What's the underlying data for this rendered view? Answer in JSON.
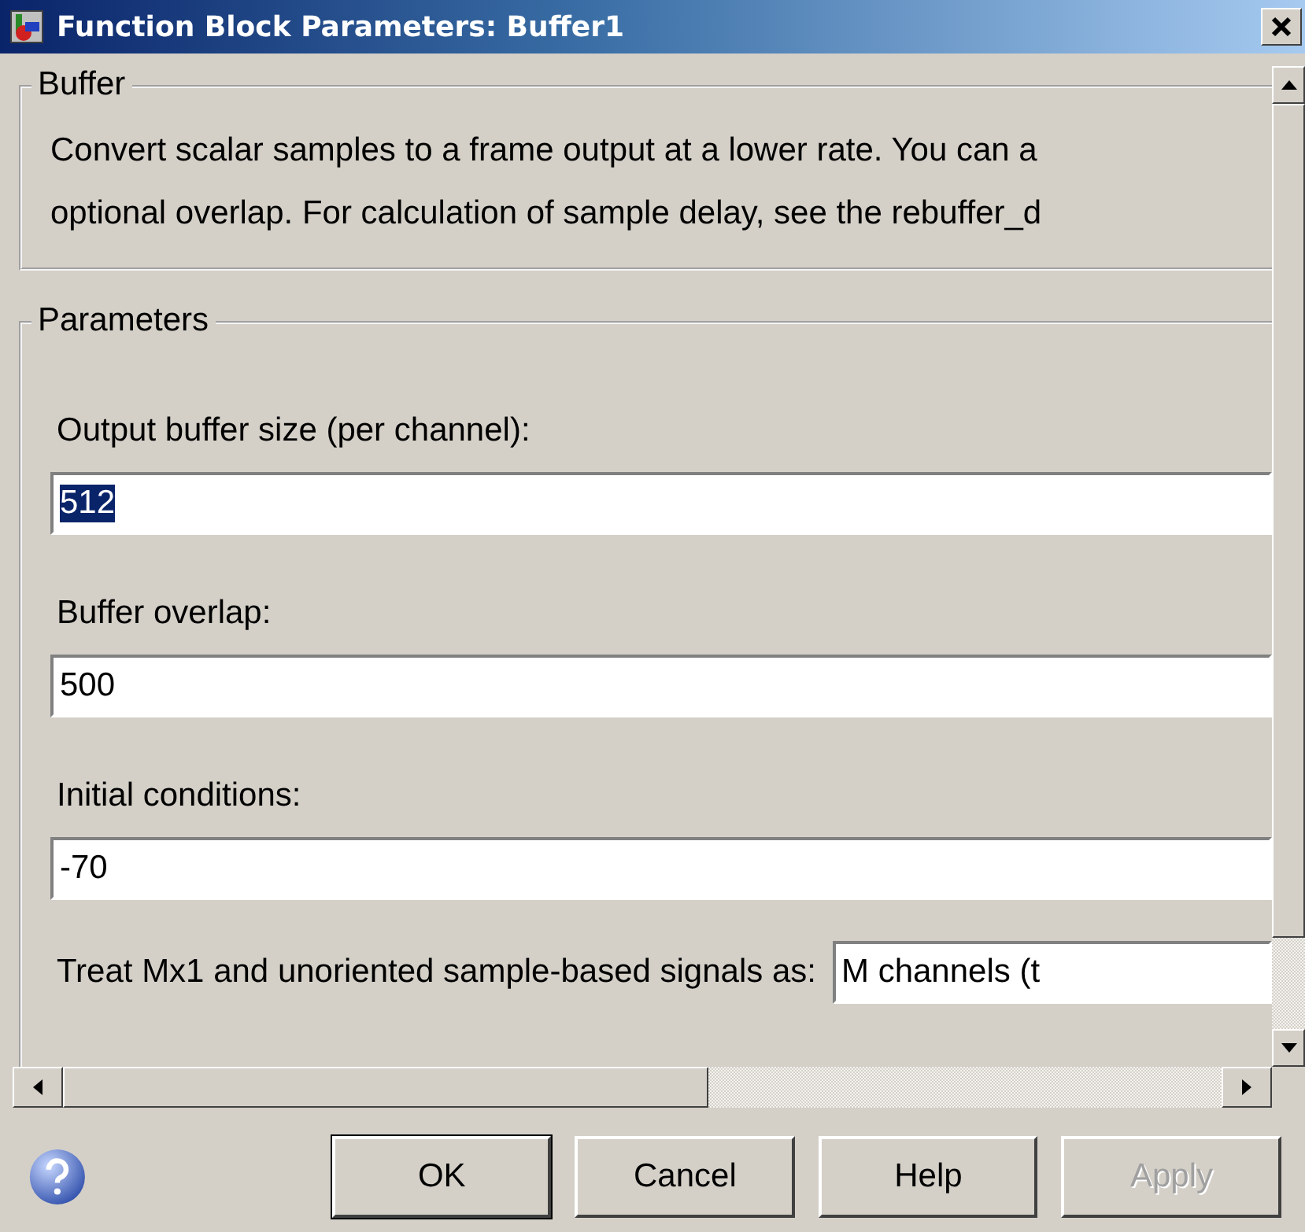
{
  "window": {
    "title": "Function Block Parameters: Buffer1"
  },
  "description_group": {
    "title": "Buffer",
    "lines": [
      "Convert scalar samples to a frame output at a lower rate. You can a",
      "optional overlap. For calculation of sample delay, see the rebuffer_d"
    ]
  },
  "parameters_group": {
    "title": "Parameters",
    "fields": [
      {
        "label": "Output buffer size (per channel):",
        "value": "512",
        "text_selected": true
      },
      {
        "label": "Buffer overlap:",
        "value": "500",
        "text_selected": false
      },
      {
        "label": "Initial conditions:",
        "value": "-70",
        "text_selected": false
      }
    ],
    "dropdown": {
      "label": "Treat Mx1 and unoriented sample-based signals as:",
      "value": "M channels (t"
    }
  },
  "buttons": [
    {
      "label": "OK",
      "disabled": false,
      "default": true
    },
    {
      "label": "Cancel",
      "disabled": false,
      "default": false
    },
    {
      "label": "Help",
      "disabled": false,
      "default": false
    },
    {
      "label": "Apply",
      "disabled": true,
      "default": false
    }
  ]
}
